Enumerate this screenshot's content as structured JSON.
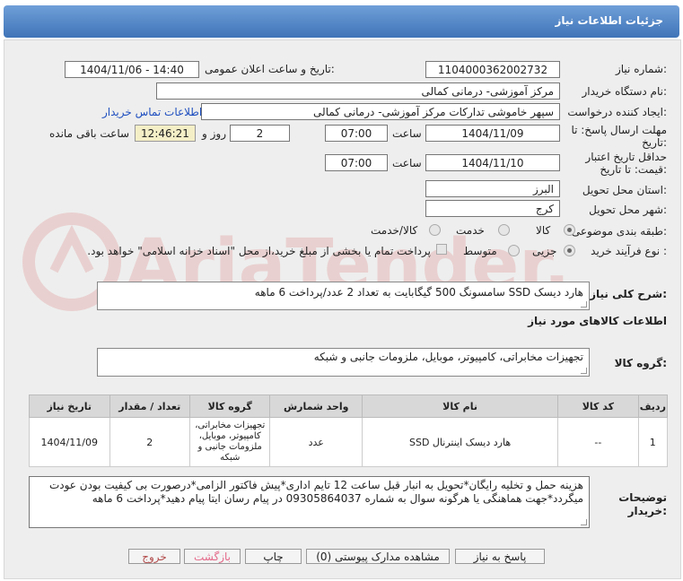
{
  "header": {
    "title": "جزئیات اطلاعات نیاز"
  },
  "form": {
    "need_number_label": "شماره نیاز:",
    "need_number": "1104000362002732",
    "announce_label": "تاریخ و ساعت اعلان عمومی:",
    "announce_value": "1404/11/06 - 14:40",
    "buyer_org_label": "نام دستگاه خریدار:",
    "buyer_org": "مرکز آموزشی- درمانی کمالی",
    "creator_label": "ایجاد کننده درخواست:",
    "creator": "سپهر خاموشی تدارکات مرکز آموزشی- درمانی کمالی",
    "contact_link": "اطلاعات تماس خریدار",
    "deadline_label_1": "مهلت ارسال پاسخ: تا",
    "deadline_label_2": "تاریخ:",
    "deadline_date": "1404/11/09",
    "time_label": "ساعت",
    "deadline_time": "07:00",
    "days_value": "2",
    "days_label": "روز و",
    "remaining_time": "12:46:21",
    "remaining_label": "ساعت باقی مانده",
    "validity_label_1": "حداقل تاریخ اعتبار",
    "validity_label_2": "قیمت: تا تاریخ:",
    "validity_date": "1404/11/10",
    "validity_time": "07:00",
    "province_label": "استان محل تحویل:",
    "province": "البرز",
    "city_label": "شهر محل تحویل:",
    "city": "کرج",
    "category_label": "طبقه بندی موضوعی:",
    "category_options": [
      "کالا",
      "خدمت",
      "کالا/خدمت"
    ],
    "purchase_type_label": "نوع فرآیند خرید :",
    "purchase_options": [
      "جزیی",
      "متوسط"
    ],
    "purchase_note": "پرداخت تمام یا بخشی از مبلغ خرید،از محل \"اسناد خزانه اسلامی\" خواهد بود.",
    "summary_label": "شرح کلی نیاز:",
    "summary": "هارد دیسک SSD سامسونگ 500 گیگابایت به تعداد 2 عدد/پرداخت 6 ماهه",
    "goods_info_title": "اطلاعات کالاهای مورد نیاز",
    "goods_group_label": "گروه کالا:",
    "goods_group": "تجهیزات مخابراتی، کامپیوتر، موبایل، ملزومات جانبی و شبکه",
    "buyer_notes_label_1": "توضیحات",
    "buyer_notes_label_2": "خریدار:",
    "buyer_notes": "هزینه حمل و تخلیه رایگان*تحویل به انبار قبل ساعت 12 تایم اداری*پیش فاکتور الزامی*درصورت بی کیفیت بودن عودت میگردد*جهت هماهنگی یا هرگونه سوال به شماره 09305864037 در پیام رسان ایتا پیام دهید*پرداخت 6 ماهه"
  },
  "table": {
    "headers": [
      "ردیف",
      "کد کالا",
      "نام کالا",
      "واحد شمارش",
      "گروه کالا",
      "تعداد / مقدار",
      "تاریخ نیاز"
    ],
    "rows": [
      {
        "row": "1",
        "code": "--",
        "name": "هارد دیسک اینترنال SSD",
        "unit": "عدد",
        "group": "تجهیزات مخابراتی، کامپیوتر، موبایل، ملزومات جانبی و شبکه",
        "qty": "2",
        "date": "1404/11/09"
      }
    ]
  },
  "buttons": {
    "reply": "پاسخ به نیاز",
    "docs": "مشاهده مدارک پیوستی (0)",
    "print": "چاپ",
    "back": "بازگشت",
    "exit": "خروج"
  },
  "watermark": "AriaTender.neT"
}
